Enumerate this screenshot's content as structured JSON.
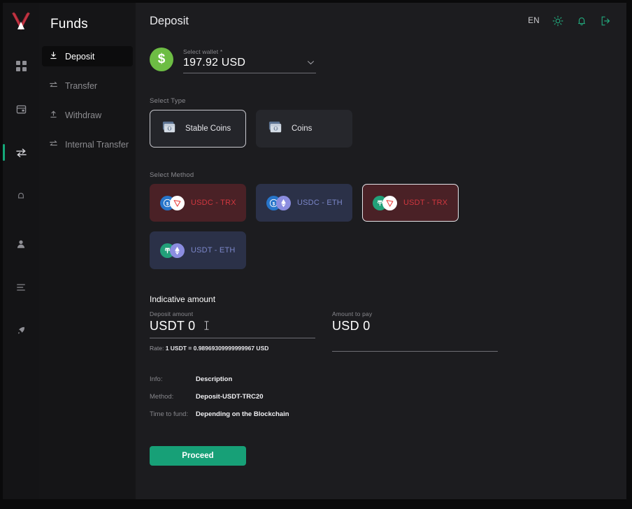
{
  "brand": {
    "logo_name": "v-logo",
    "accent": "#15a87a"
  },
  "rail": {
    "items": [
      {
        "name": "dashboard-grid-icon",
        "label": "Dashboard",
        "active": false
      },
      {
        "name": "wallet-card-icon",
        "label": "Accounts",
        "active": false
      },
      {
        "name": "funds-transfer-icon",
        "label": "Funds",
        "active": true
      },
      {
        "name": "bell-icon",
        "label": "Alerts",
        "active": false
      },
      {
        "name": "user-icon",
        "label": "Profile",
        "active": false
      },
      {
        "name": "list-icon",
        "label": "Reports",
        "active": false
      },
      {
        "name": "rocket-icon",
        "label": "Tools",
        "active": false
      }
    ]
  },
  "sidebar": {
    "title": "Funds",
    "items": [
      {
        "label": "Deposit",
        "icon": "deposit-arrow-icon",
        "active": true
      },
      {
        "label": "Transfer",
        "icon": "swap-arrows-icon",
        "active": false
      },
      {
        "label": "Withdraw",
        "icon": "withdraw-arrow-icon",
        "active": false
      },
      {
        "label": "Internal Transfer",
        "icon": "swap-arrows-icon",
        "active": false
      }
    ]
  },
  "topbar": {
    "title": "Deposit",
    "language": "EN",
    "icons": [
      {
        "name": "sun-theme-icon"
      },
      {
        "name": "bell-notification-icon"
      },
      {
        "name": "logout-icon"
      }
    ]
  },
  "wallet": {
    "label": "Select wallet *",
    "value": "197.92 USD",
    "badge_symbol": "$",
    "chevron": "chevron-down-icon"
  },
  "select_type": {
    "label": "Select Type",
    "options": [
      {
        "label": "Stable Coins",
        "selected": true
      },
      {
        "label": "Coins",
        "selected": false
      }
    ]
  },
  "select_method": {
    "label": "Select Method",
    "options": [
      {
        "label": "USDC - TRX",
        "network": "trx",
        "coin_a": "USDC",
        "coin_b": "TRX",
        "selected": false
      },
      {
        "label": "USDC - ETH",
        "network": "eth",
        "coin_a": "USDC",
        "coin_b": "ETH",
        "selected": false
      },
      {
        "label": "USDT - TRX",
        "network": "trx",
        "coin_a": "USDT",
        "coin_b": "TRX",
        "selected": true
      },
      {
        "label": "USDT - ETH",
        "network": "eth",
        "coin_a": "USDT",
        "coin_b": "ETH",
        "selected": false
      }
    ]
  },
  "indicative": {
    "title": "Indicative amount",
    "deposit": {
      "label": "Deposit amount",
      "value": "USDT 0",
      "placeholder": "USDT 0"
    },
    "pay": {
      "label": "Amount to pay",
      "value": "USD 0",
      "placeholder": "USD 0"
    },
    "rate_prefix": "Rate:",
    "rate_value": "1 USDT = 0.98969309999999967 USD"
  },
  "info": {
    "rows": [
      {
        "key": "Info:",
        "value": "Description"
      },
      {
        "key": "Method:",
        "value": "Deposit-USDT-TRC20"
      },
      {
        "key": "Time to fund:",
        "value": "Depending on the Blockchain"
      }
    ]
  },
  "actions": {
    "proceed_label": "Proceed"
  }
}
